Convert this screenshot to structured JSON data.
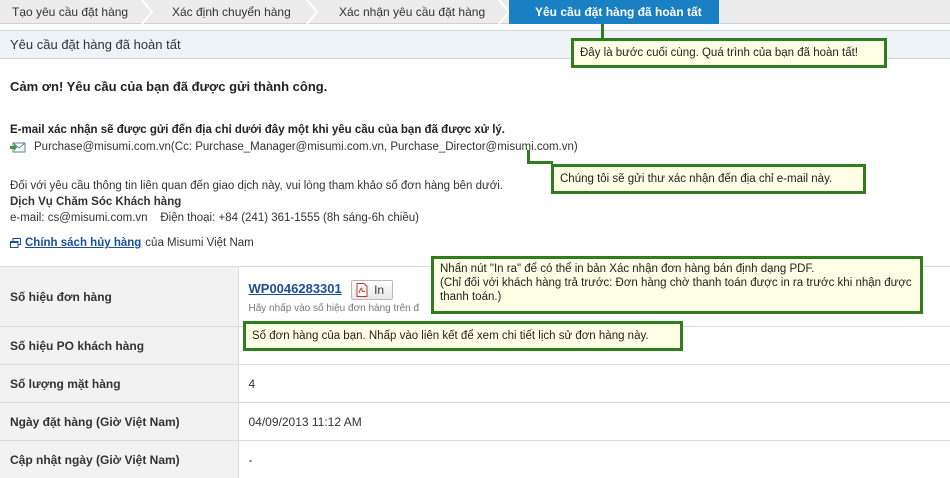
{
  "steps": [
    {
      "label": "Tạo yêu cầu đặt hàng"
    },
    {
      "label": "Xác định chuyển hàng"
    },
    {
      "label": "Xác nhận yêu cầu đặt hàng"
    },
    {
      "label": "Yêu cầu đặt hàng đã hoàn tất"
    }
  ],
  "page_title": "Yêu cầu đặt hàng đã hoàn tất",
  "thanks": "Cảm ơn! Yêu cầu của bạn đã được gửi thành công.",
  "email_note": "E-mail xác nhận sẽ được gửi đến địa chỉ dưới đây một khi yêu cầu của bạn đã được xử lý.",
  "email_addresses": "Purchase@misumi.com.vn(Cc: Purchase_Manager@misumi.com.vn, Purchase_Director@misumi.com.vn)",
  "info": {
    "line1": "Đối với yêu cầu thông tin liên quan đến giao dịch này, vui lòng tham khảo số đơn hàng bên dưới.",
    "service": "Dịch Vụ Chăm Sóc Khách hàng",
    "contact": "e-mail: cs@misumi.com.vn    Điện thoại: +84 (241) 361-1555 (8h sáng-6h chiều)"
  },
  "cancel": {
    "link": "Chính sách hủy hàng",
    "suffix": "của Misumi Việt Nam"
  },
  "table": {
    "order_no_label": "Số hiệu đơn hàng",
    "order_no": "WP0046283301",
    "print_button": "In",
    "order_hint": "Hãy nhấp vào số hiệu đơn hàng trên đ",
    "po_label": "Số hiệu PO khách hàng",
    "po_value": "-",
    "qty_label": "Số lượng mặt hàng",
    "qty_value": "4",
    "date_label": "Ngày đặt hàng (Giờ Việt Nam)",
    "date_value": "04/09/2013 11:12 AM",
    "update_label": "Cập nhật ngày (Giờ Việt Nam)",
    "update_value": "-"
  },
  "tooltips": {
    "final_step": "Đây là bước cuối cùng. Quá trình của bạn đã hoàn tất!",
    "email": "Chúng tôi sẽ gửi thư xác nhận đến địa chỉ e-mail này.",
    "print_line1": "Nhấn nút \"In ra\" để có thể in bản Xác nhận đơn hàng bán định dạng PDF.",
    "print_line2": "(Chỉ đối với khách hàng trả trước: Đơn hàng chờ thanh toán được in ra trước khi nhận được thanh toán.)",
    "order_no": "Số đơn hàng của bạn. Nhấp vào liên kết để xem chi tiết lịch sử đơn hàng này."
  },
  "colors": {
    "active_step": "#1a80c4",
    "tooltip_border": "#2f7d1e",
    "tooltip_bg": "#ffffe6",
    "link": "#1a4f99"
  }
}
